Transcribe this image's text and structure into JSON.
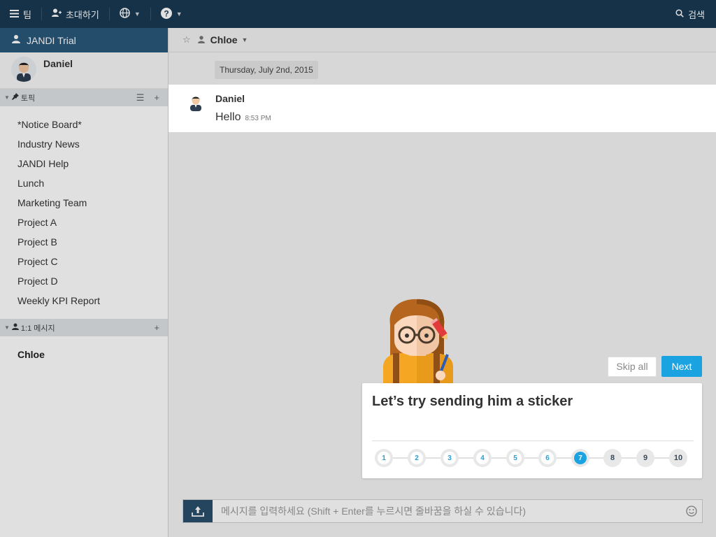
{
  "topbar": {
    "team_label": "팀",
    "invite_label": "초대하기",
    "search_label": "검색"
  },
  "sidebar": {
    "team_name": "JANDI Trial",
    "profile_name": "Daniel",
    "topics_header": "토픽",
    "topics": [
      "*Notice Board*",
      "Industry News",
      "JANDI Help",
      "Lunch",
      "Marketing Team",
      "Project A",
      "Project B",
      "Project C",
      "Project D",
      "Weekly KPI Report"
    ],
    "dm_header": "1:1 메시지",
    "dms": [
      "Chloe"
    ]
  },
  "chat": {
    "header_name": "Chloe",
    "date_label": "Thursday, July 2nd, 2015",
    "message": {
      "author": "Daniel",
      "text": "Hello",
      "time": "8:53 PM"
    },
    "composer_placeholder": "메시지를 입력하세요 (Shift + Enter를 누르시면 줄바꿈을 하실 수 있습니다)"
  },
  "tutorial": {
    "skip_label": "Skip all",
    "next_label": "Next",
    "title": "Let’s try sending him a sticker",
    "steps": [
      "1",
      "2",
      "3",
      "4",
      "5",
      "6",
      "7",
      "8",
      "9",
      "10"
    ],
    "current_step": 7
  },
  "colors": {
    "topbar": "#183a52",
    "team_header": "#2a587a",
    "accent": "#1aa3e0"
  }
}
